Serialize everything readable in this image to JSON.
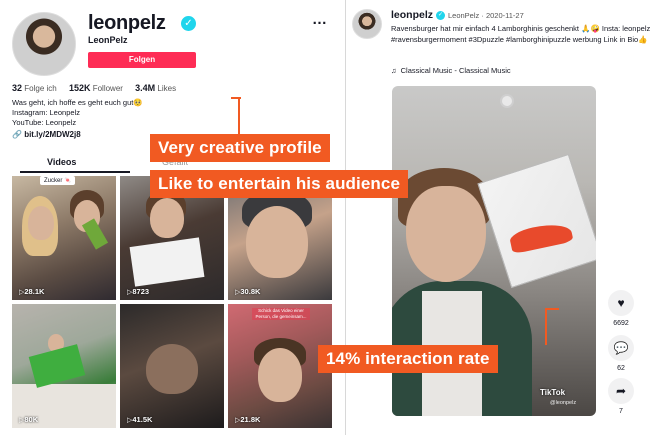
{
  "profile": {
    "username": "leonpelz",
    "nickname": "LeonPelz",
    "follow_label": "Folgen",
    "more_icon": "…",
    "stats": {
      "following_count": "32",
      "following_label": "Folge ich",
      "followers_count": "152K",
      "followers_label": "Follower",
      "likes_count": "3.4M",
      "likes_label": "Likes"
    },
    "bio": [
      "Was geht, ich hoffe es geht euch gut🥺",
      "Instagram: Leonpelz",
      "YouTube: Leonpelz"
    ],
    "link": "bit.ly/2MDW2j8",
    "tabs": {
      "videos": "Videos",
      "liked": "Gefällt"
    }
  },
  "videos": [
    {
      "views": "28.1K",
      "sticker": "Zucker 🍬"
    },
    {
      "views": "8723"
    },
    {
      "views": "30.8K"
    },
    {
      "views": "80K"
    },
    {
      "views": "41.5K"
    },
    {
      "views": "21.8K",
      "overlay_text": "Schick das Video einer Person, die gemeinsam..."
    }
  ],
  "post": {
    "username": "leonpelz",
    "meta": "LeonPelz · 2020-11-27",
    "description": "Ravensburger hat mir einfach 4 Lamborghinis geschenkt 🙏🤪 Insta: leonpelz #ravensburgermoment #3Dpuzzle #lamborghinipuzzle werbung Link in Bio👍",
    "music": "Classical Music - Classical Music",
    "watermark": "TikTok",
    "watermark_handle": "@leonpelz",
    "actions": {
      "likes": "6692",
      "comments": "62",
      "shares": "7"
    }
  },
  "annotations": {
    "profile": "Very creative profile",
    "entertain": "Like to entertain his audience",
    "interaction": "14% interaction rate"
  },
  "colors": {
    "accent_orange": "#f15a22",
    "follow_red": "#fe2c55",
    "verified_blue": "#20d5ec"
  }
}
